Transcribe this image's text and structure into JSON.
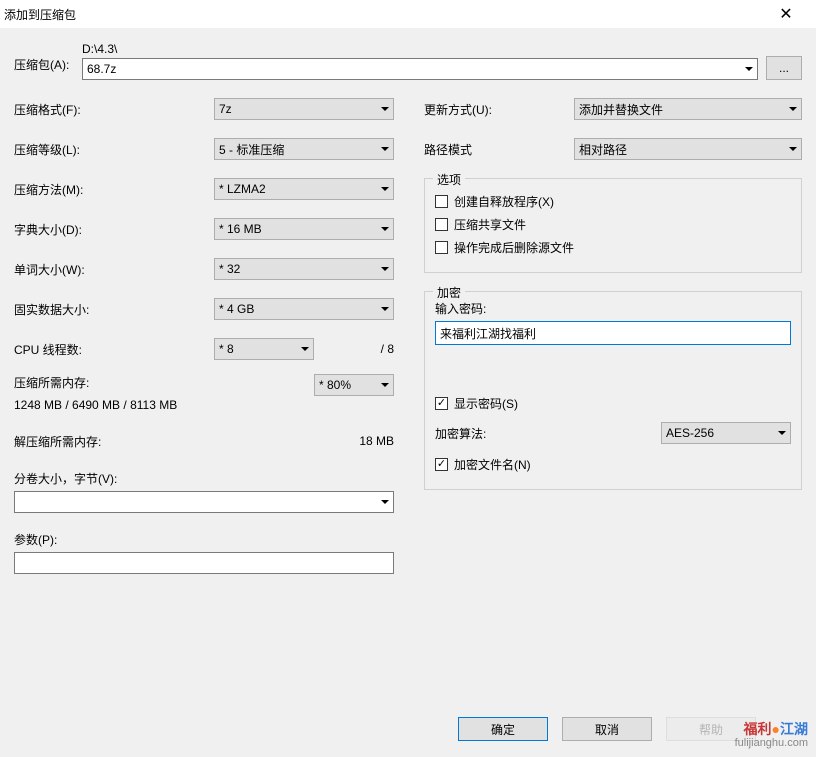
{
  "window": {
    "title": "添加到压缩包"
  },
  "archive": {
    "label": "压缩包(A):",
    "path": "D:\\4.3\\",
    "filename": "68.7z",
    "browse": "..."
  },
  "left": {
    "format": {
      "label": "压缩格式(F):",
      "value": "7z"
    },
    "level": {
      "label": "压缩等级(L):",
      "value": "5 - 标准压缩"
    },
    "method": {
      "label": "压缩方法(M):",
      "value": "* LZMA2"
    },
    "dict": {
      "label": "字典大小(D):",
      "value": "* 16 MB"
    },
    "word": {
      "label": "单词大小(W):",
      "value": "* 32"
    },
    "solid": {
      "label": "固实数据大小:",
      "value": "* 4 GB"
    },
    "threads": {
      "label": "CPU 线程数:",
      "value": "* 8",
      "total": "/ 8"
    },
    "mem_comp": {
      "label": "压缩所需内存:",
      "values": "1248 MB / 6490 MB / 8113 MB",
      "pct": "* 80%"
    },
    "mem_decomp": {
      "label": "解压缩所需内存:",
      "value": "18 MB"
    },
    "split": {
      "label": "分卷大小，字节(V):"
    },
    "params": {
      "label": "参数(P):"
    }
  },
  "right": {
    "update": {
      "label": "更新方式(U):",
      "value": "添加并替换文件"
    },
    "pathmode": {
      "label": "路径模式",
      "value": "相对路径"
    },
    "options": {
      "legend": "选项",
      "sfx": "创建自释放程序(X)",
      "shared": "压缩共享文件",
      "delete": "操作完成后删除源文件"
    },
    "encryption": {
      "legend": "加密",
      "pwd_label": "输入密码:",
      "pwd_value": "来福利江湖找福利",
      "show_pwd": "显示密码(S)",
      "algo_label": "加密算法:",
      "algo_value": "AES-256",
      "enc_names": "加密文件名(N)"
    }
  },
  "buttons": {
    "ok": "确定",
    "cancel": "取消",
    "help": "帮助"
  },
  "watermark": {
    "brand_a": "福利",
    "brand_b": "江湖",
    "url": "fulijianghu.com"
  }
}
